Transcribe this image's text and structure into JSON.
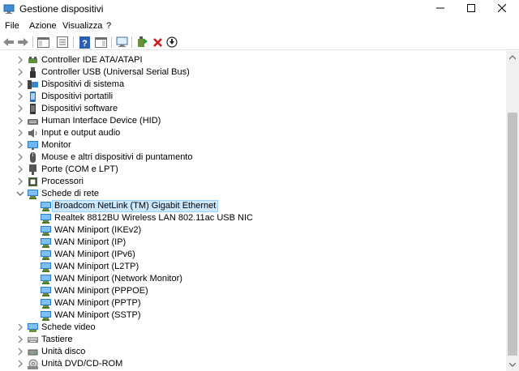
{
  "window": {
    "title": "Gestione dispositivi",
    "controls": {
      "minimize": "—",
      "maximize": "☐",
      "close": "✕"
    }
  },
  "menu": {
    "file": "File",
    "azione": "Azione",
    "visualizza": "Visualizza",
    "help": "?"
  },
  "toolbar": {
    "icons": [
      "back-arrow-icon",
      "forward-arrow-icon",
      "show-hide-console-tree-icon",
      "properties-icon",
      "help-icon",
      "action-pane-icon",
      "scan-hardware-icon",
      "enable-device-icon",
      "uninstall-device-icon",
      "update-driver-icon"
    ]
  },
  "tree": {
    "categories_top": [
      {
        "label": "Controller IDE ATA/ATAPI",
        "icon": "ide-controller-icon"
      },
      {
        "label": "Controller USB (Universal Serial Bus)",
        "icon": "usb-icon"
      },
      {
        "label": "Dispositivi di sistema",
        "icon": "system-devices-icon"
      },
      {
        "label": "Dispositivi portatili",
        "icon": "portable-device-icon"
      },
      {
        "label": "Dispositivi software",
        "icon": "software-device-icon"
      },
      {
        "label": "Human Interface Device (HID)",
        "icon": "hid-icon"
      },
      {
        "label": "Input e output audio",
        "icon": "speaker-icon"
      },
      {
        "label": "Monitor",
        "icon": "monitor-icon"
      },
      {
        "label": "Mouse e altri dispositivi di puntamento",
        "icon": "mouse-icon"
      },
      {
        "label": "Porte (COM e LPT)",
        "icon": "port-icon"
      },
      {
        "label": "Processori",
        "icon": "processor-icon"
      }
    ],
    "expanded_category": {
      "label": "Schede di rete",
      "icon": "network-adapter-icon"
    },
    "network_adapters": [
      "Broadcom NetLink (TM) Gigabit Ethernet",
      "Realtek 8812BU Wireless LAN 802.11ac USB NIC",
      "WAN Miniport (IKEv2)",
      "WAN Miniport (IP)",
      "WAN Miniport (IPv6)",
      "WAN Miniport (L2TP)",
      "WAN Miniport (Network Monitor)",
      "WAN Miniport (PPPOE)",
      "WAN Miniport (PPTP)",
      "WAN Miniport (SSTP)"
    ],
    "selected_adapter": "Broadcom NetLink (TM) Gigabit Ethernet",
    "categories_bottom": [
      {
        "label": "Schede video",
        "icon": "display-adapter-icon"
      },
      {
        "label": "Tastiere",
        "icon": "keyboard-icon"
      },
      {
        "label": "Unità disco",
        "icon": "disk-drive-icon"
      },
      {
        "label": "Unità DVD/CD-ROM",
        "icon": "dvd-drive-icon"
      }
    ]
  },
  "colors": {
    "selection": "#cce8ff",
    "selection_border": "#99d1ff",
    "scroll_thumb": "#c2c2c2"
  }
}
